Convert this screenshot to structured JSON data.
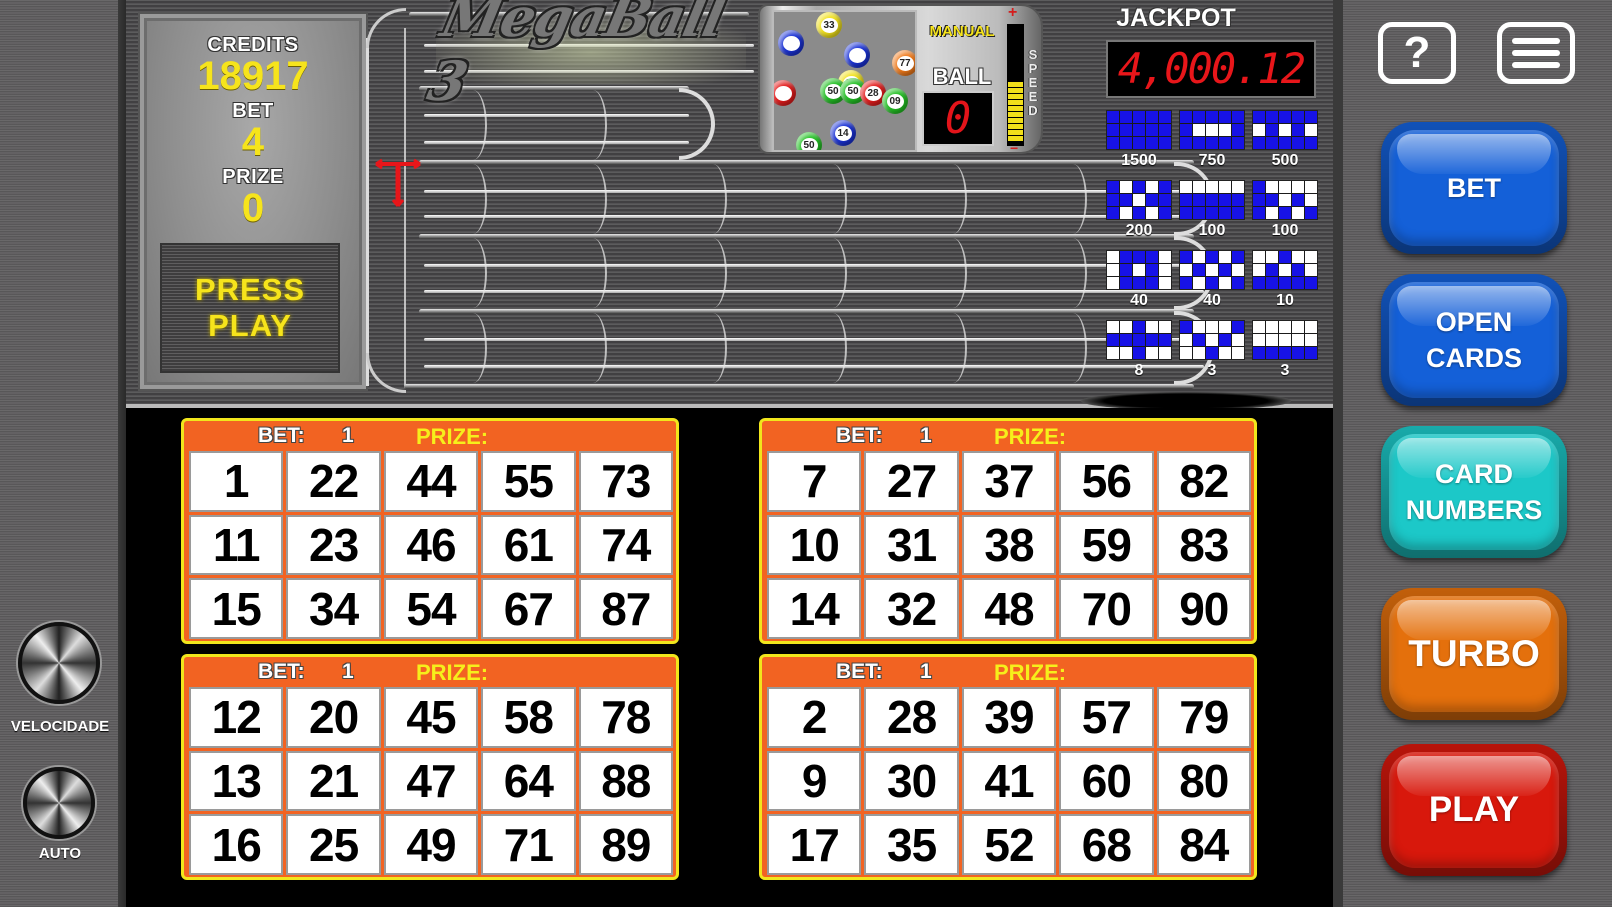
{
  "game": {
    "title": "MegaBall 3"
  },
  "info_panel": {
    "credits_label": "CREDITS",
    "credits_value": "18917",
    "bet_label": "BET",
    "bet_value": "4",
    "prize_label": "PRIZE",
    "prize_value": "0",
    "press_play_line1": "PRESS",
    "press_play_line2": "PLAY"
  },
  "ball_machine": {
    "mode_label": "MANUAL",
    "ball_label": "BALL",
    "ball_count": "0",
    "speed_label": "SPEED",
    "speed_level_fraction": 0.5,
    "visible_balls": [
      {
        "number": "33",
        "color": "#f1e11c"
      },
      {
        "number": "77",
        "color": "#f07a1a"
      },
      {
        "number": "33",
        "color": "#f1e11c"
      },
      {
        "number": "50",
        "color": "#23c124"
      },
      {
        "number": "50",
        "color": "#23c124"
      },
      {
        "number": "28",
        "color": "#e41c1c"
      },
      {
        "number": "09",
        "color": "#23c124"
      },
      {
        "number": "50",
        "color": "#23c124"
      },
      {
        "number": "14",
        "color": "#1a32d6"
      },
      {
        "number": "",
        "color": "#1a32d6"
      },
      {
        "number": "",
        "color": "#1a32d6"
      },
      {
        "number": "",
        "color": "#e41c1c"
      }
    ]
  },
  "jackpot": {
    "label": "JACKPOT",
    "value": "4,000.12"
  },
  "paytable": [
    {
      "prize": "1500",
      "pattern": [
        "BBBBB",
        "BBBBB",
        "BBBBB"
      ]
    },
    {
      "prize": "750",
      "pattern": [
        "BBBBB",
        "BWWWB",
        "BBBBB"
      ]
    },
    {
      "prize": "500",
      "pattern": [
        "BBBBB",
        "WBWBW",
        "BBBBB"
      ]
    },
    {
      "prize": "200",
      "pattern": [
        "BWBWB",
        "BBWBB",
        "BWBWB"
      ]
    },
    {
      "prize": "100",
      "pattern": [
        "WWWWW",
        "BBBBB",
        "BBBBB"
      ]
    },
    {
      "prize": "100",
      "pattern": [
        "BWWWW",
        "BBWBW",
        "BWBWB"
      ]
    },
    {
      "prize": "40",
      "pattern": [
        "WBBBW",
        "WBWBW",
        "WBBBW"
      ]
    },
    {
      "prize": "40",
      "pattern": [
        "BWBWB",
        "WBWBW",
        "BWBWB"
      ]
    },
    {
      "prize": "10",
      "pattern": [
        "WWBWW",
        "WBWBW",
        "BBBBB"
      ]
    },
    {
      "prize": "8",
      "pattern": [
        "WWBWW",
        "BBBBB",
        "WWBWW"
      ]
    },
    {
      "prize": "3",
      "pattern": [
        "BWWWB",
        "WBWBW",
        "WWBWW"
      ]
    },
    {
      "prize": "3",
      "pattern": [
        "WWWWW",
        "WWWWW",
        "BBBBB"
      ]
    }
  ],
  "cards": [
    {
      "bet_label": "BET:",
      "bet_value": "1",
      "prize_label": "PRIZE:",
      "numbers": [
        [
          "1",
          "22",
          "44",
          "55",
          "73"
        ],
        [
          "11",
          "23",
          "46",
          "61",
          "74"
        ],
        [
          "15",
          "34",
          "54",
          "67",
          "87"
        ]
      ]
    },
    {
      "bet_label": "BET:",
      "bet_value": "1",
      "prize_label": "PRIZE:",
      "numbers": [
        [
          "7",
          "27",
          "37",
          "56",
          "82"
        ],
        [
          "10",
          "31",
          "38",
          "59",
          "83"
        ],
        [
          "14",
          "32",
          "48",
          "70",
          "90"
        ]
      ]
    },
    {
      "bet_label": "BET:",
      "bet_value": "1",
      "prize_label": "PRIZE:",
      "numbers": [
        [
          "12",
          "20",
          "45",
          "58",
          "78"
        ],
        [
          "13",
          "21",
          "47",
          "64",
          "88"
        ],
        [
          "16",
          "25",
          "49",
          "71",
          "89"
        ]
      ]
    },
    {
      "bet_label": "BET:",
      "bet_value": "1",
      "prize_label": "PRIZE:",
      "numbers": [
        [
          "2",
          "28",
          "39",
          "57",
          "79"
        ],
        [
          "9",
          "30",
          "41",
          "60",
          "80"
        ],
        [
          "17",
          "35",
          "52",
          "68",
          "84"
        ]
      ]
    }
  ],
  "controls": {
    "help_icon": "question-mark-icon",
    "menu_icon": "hamburger-menu-icon",
    "bet_button": "BET",
    "open_cards_line1": "OPEN",
    "open_cards_line2": "CARDS",
    "card_numbers_line1": "CARD",
    "card_numbers_line2": "NUMBERS",
    "turbo_button": "TURBO",
    "play_button": "PLAY",
    "colors": {
      "bet": "#1460d8",
      "open_cards": "#1460d8",
      "card_numbers": "#1cc8c8",
      "turbo": "#e4700c",
      "play": "#d8180c"
    }
  },
  "knobs": {
    "speed_label": "VELOCIDADE",
    "auto_label": "AUTO"
  },
  "colors": {
    "card_orange": "#f26322",
    "card_border_yellow": "#f1e61c",
    "led_red": "#e8161a",
    "text_yellow": "#f6e41c",
    "paytable_blue": "#1712e6",
    "paytable_line": "#e0204e"
  }
}
